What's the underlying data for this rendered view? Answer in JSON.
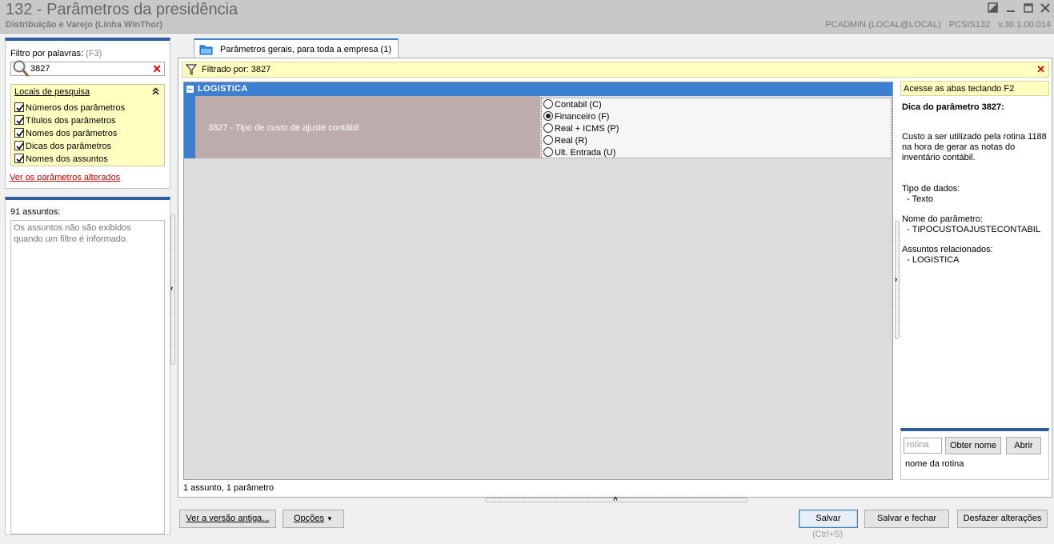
{
  "window": {
    "title": "132 - Parâmetros da presidência",
    "subtitle": "Distribuição e Varejo (Linha WinThor)",
    "user": "PCADMIN (LOCAL@LOCAL)",
    "module": "PCSIS132",
    "version": "v.30.1.00.014"
  },
  "filter": {
    "label": "Filtro por palavras:",
    "shortcut": "(F3)",
    "value": "3827"
  },
  "locais": {
    "title": "Locais de pesquisa",
    "items": [
      {
        "label": "Números dos parâmetros",
        "checked": true
      },
      {
        "label": "Títulos dos parâmetros",
        "checked": true
      },
      {
        "label": "Nomes dos parâmetros",
        "checked": true
      },
      {
        "label": "Dicas dos parâmetros",
        "checked": true
      },
      {
        "label": "Nomes dos assuntos",
        "checked": true
      }
    ]
  },
  "changed_link": "Ver os parâmetros alterados",
  "assuntos": {
    "count_label": "91 assuntos:",
    "message": "Os assuntos não são exibidos quando um filtro é informado."
  },
  "tab": {
    "label": "Parâmetros gerais, para toda a empresa  (1)"
  },
  "filtered": {
    "label": "Filtrado por: 3827"
  },
  "group": {
    "name": "LOGISTICA"
  },
  "param": {
    "title": "3827 - Tipo de custo de ajuste contábil",
    "options": [
      {
        "label": "Contabil  (C)",
        "selected": false
      },
      {
        "label": "Financeiro  (F)",
        "selected": true
      },
      {
        "label": "Real + ICMS  (P)",
        "selected": false
      },
      {
        "label": "Real  (R)",
        "selected": false
      },
      {
        "label": "Ult. Entrada  (U)",
        "selected": false
      }
    ]
  },
  "summary": "1 assunto, 1 parâmetro",
  "hint": {
    "tabs_tip": "Acesse as abas teclando F2",
    "title": "Dica do parâmetro 3827:",
    "description": "Custo a ser utilizado pela rotina 1188 na hora de gerar as notas do inventário contábil.",
    "type_label": "Tipo de dados:",
    "type_value": "- Texto",
    "name_label": "Nome do parâmetro:",
    "name_value": "- TIPOCUSTOAJUSTECONTABIL",
    "subjects_label": "Assuntos relacionados:",
    "subjects_value": "- LOGISTICA"
  },
  "rotina": {
    "placeholder": "rotina",
    "get_name_button": "Obter nome",
    "open_button": "Abrir",
    "name_label": "nome da rotina"
  },
  "buttons": {
    "old_version": "Ver a versão antiga...",
    "options": "Opções",
    "save": "Salvar",
    "save_shortcut": "(Ctrl+S)",
    "save_close": "Salvar e fechar",
    "undo": "Desfazer alterações"
  },
  "colors": {
    "accent_blue": "#3d7fd0",
    "panel_blue": "#2d5d9f",
    "hint_yellow": "#ffffc0",
    "param_row": "#bcadac",
    "clear_red": "#e00000"
  },
  "icons": [
    "search-icon",
    "clear-icon",
    "collapse-icon",
    "folder-icon",
    "filter-icon",
    "close-icon",
    "restore-icon",
    "minimize-icon",
    "maximize-icon"
  ]
}
